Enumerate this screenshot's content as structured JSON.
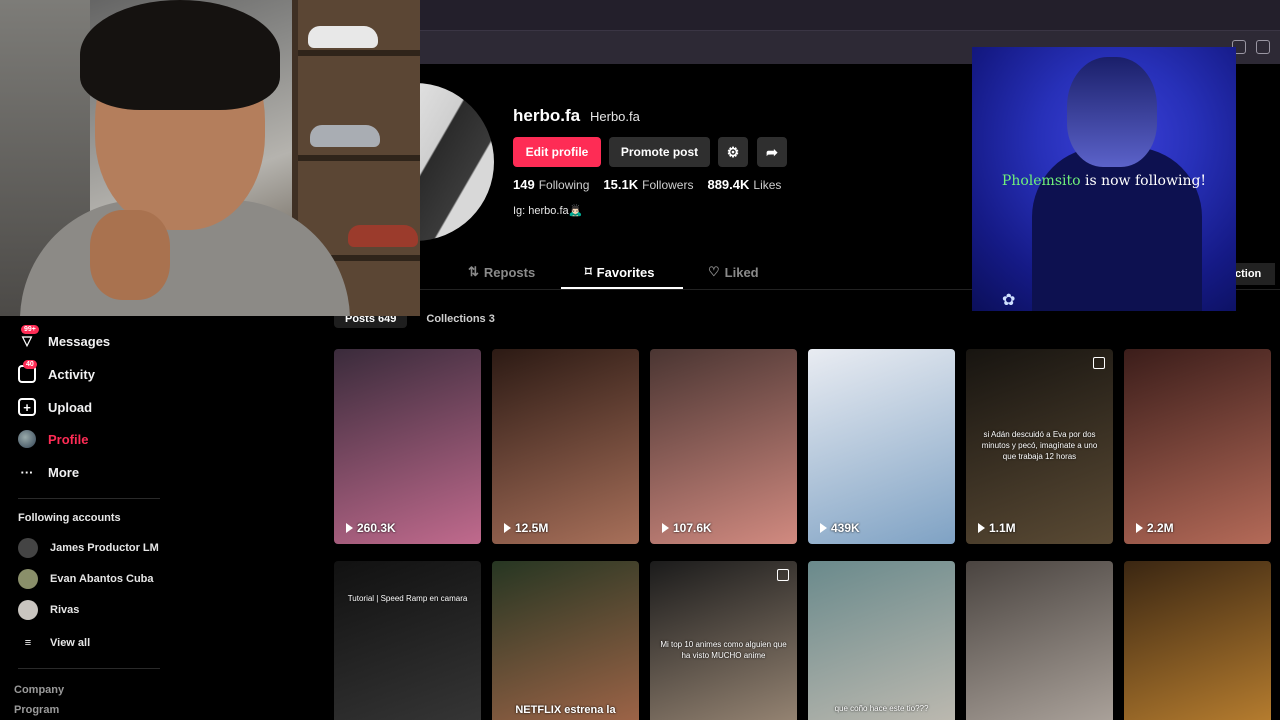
{
  "profile": {
    "username": "herbo.fa",
    "nickname": "Herbo.fa",
    "edit_label": "Edit profile",
    "promote_label": "Promote post",
    "following_count": "149",
    "following_label": "Following",
    "followers_count": "15.1K",
    "followers_label": "Followers",
    "likes_count": "889.4K",
    "likes_label": "Likes",
    "bio": "Ig: herbo.fa🙇🏻‍♂️"
  },
  "tabs": {
    "reposts": "Reposts",
    "favorites": "Favorites",
    "liked": "Liked",
    "collection_chip": "ction"
  },
  "subtabs": {
    "posts": "Posts 649",
    "collections": "Collections 3"
  },
  "sidebar": {
    "messages": "Messages",
    "messages_badge": "99+",
    "activity": "Activity",
    "activity_badge": "40",
    "upload": "Upload",
    "profile": "Profile",
    "more": "More",
    "following_header": "Following accounts",
    "following": [
      "James Productor LM",
      "Evan Abantos Cuba",
      "Rivas"
    ],
    "view_all": "View all",
    "footer": [
      "Company",
      "Program"
    ]
  },
  "videos_row1": [
    {
      "views": "260.3K",
      "caption": "",
      "colors": [
        "#3a2b3b",
        "#c06a8d"
      ]
    },
    {
      "views": "12.5M",
      "caption": "",
      "colors": [
        "#2c1a14",
        "#a8705a"
      ]
    },
    {
      "views": "107.6K",
      "caption": "",
      "colors": [
        "#4a3532",
        "#d18a80"
      ]
    },
    {
      "views": "439K",
      "caption": "",
      "colors": [
        "#e9ecf2",
        "#7fa2c4"
      ]
    },
    {
      "views": "1.1M",
      "caption": "si Adán descuidó a Eva por dos minutos y pecó, imagínate a uno que trabaja 12 horas",
      "colors": [
        "#171410",
        "#5a4a34"
      ]
    },
    {
      "views": "2.2M",
      "caption": "",
      "colors": [
        "#3b1d1a",
        "#b46a58"
      ]
    }
  ],
  "videos_row2": [
    {
      "caption": "Tutorial | Speed Ramp en camara",
      "colors": [
        "#111",
        "#3b3b3b"
      ]
    },
    {
      "caption": "NETFLIX estrena la",
      "colors": [
        "#263622",
        "#b06b4d"
      ]
    },
    {
      "caption": "Mi top 10 animes como alguien que ha visto MUCHO anime",
      "colors": [
        "#1b1b1b",
        "#a89480"
      ]
    },
    {
      "caption": "que coño hace este tio???",
      "colors": [
        "#6a8a8c",
        "#c9c0b5"
      ]
    },
    {
      "caption": "",
      "colors": [
        "#4a4440",
        "#b9b0a8"
      ]
    },
    {
      "caption": "",
      "colors": [
        "#3a2612",
        "#c98a33"
      ]
    }
  ],
  "notification": {
    "name": "Pholemsito",
    "message": " is now following!"
  },
  "accent": "#fe2c55"
}
